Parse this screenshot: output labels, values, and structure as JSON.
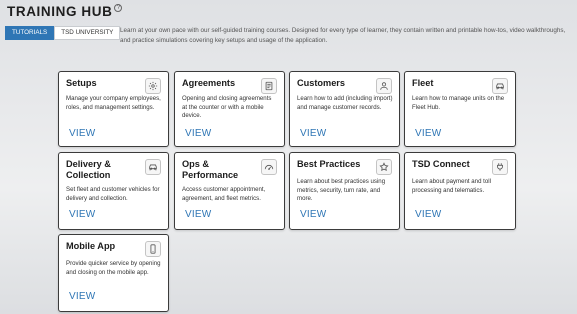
{
  "header": {
    "title": "TRAINING HUB",
    "help_glyph": "?"
  },
  "tabs": [
    {
      "label": "TUTORIALS",
      "active": true
    },
    {
      "label": "TSD UNIVERSITY",
      "active": false
    }
  ],
  "intro": "Learn at your own pace with our self-guided training courses. Designed for every type of learner, they contain written and printable how-tos, video walkthroughs, and practice simulations covering key setups and usage of the application.",
  "cards": [
    {
      "title": "Setups",
      "icon": "gear-icon",
      "description": "Manage your company employees, roles, and management settings.",
      "action": "VIEW"
    },
    {
      "title": "Agreements",
      "icon": "document-icon",
      "description": "Opening and closing agreements at the counter or with a mobile device.",
      "action": "VIEW"
    },
    {
      "title": "Customers",
      "icon": "user-icon",
      "description": "Learn how to add (including import) and manage customer records.",
      "action": "VIEW"
    },
    {
      "title": "Fleet",
      "icon": "car-icon",
      "description": "Learn how to manage units on the Fleet Hub.",
      "action": "VIEW"
    },
    {
      "title": "Delivery & Collection",
      "icon": "car-icon",
      "description": "Set fleet and customer vehicles for delivery and collection.",
      "action": "VIEW"
    },
    {
      "title": "Ops & Performance",
      "icon": "speedometer-icon",
      "description": "Access customer appointment, agreement, and fleet metrics.",
      "action": "VIEW"
    },
    {
      "title": "Best Practices",
      "icon": "star-icon",
      "description": "Learn about best practices using metrics, security, turn rate, and more.",
      "action": "VIEW"
    },
    {
      "title": "TSD Connect",
      "icon": "plug-icon",
      "description": "Learn about payment and toll processing and telematics.",
      "action": "VIEW"
    },
    {
      "title": "Mobile App",
      "icon": "mobile-phone-icon",
      "description": "Provide quicker service by opening and closing on the mobile app.",
      "action": "VIEW"
    }
  ],
  "colors": {
    "accent": "#2f76b5",
    "card_border": "#3b3b3b"
  }
}
